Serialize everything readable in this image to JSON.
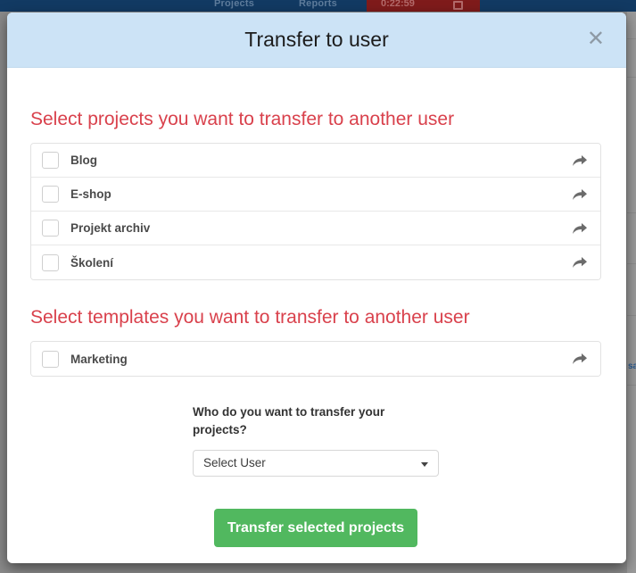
{
  "background": {
    "nav": {
      "projects_label": "Projects",
      "reports_label": "Reports",
      "timer_value": "0:22:59",
      "stop_icon": "stop-square-icon"
    },
    "right_snippet": "sa"
  },
  "modal": {
    "title": "Transfer to user",
    "close_icon": "✕",
    "projects_section": {
      "heading": "Select projects you want to transfer to another user",
      "items": [
        {
          "label": "Blog",
          "share_icon": "share-arrow-icon",
          "checked": false
        },
        {
          "label": "E-shop",
          "share_icon": "share-arrow-icon",
          "checked": false
        },
        {
          "label": "Projekt archiv",
          "share_icon": "share-arrow-icon",
          "checked": false
        },
        {
          "label": "Školení",
          "share_icon": "share-arrow-icon",
          "checked": false
        }
      ]
    },
    "templates_section": {
      "heading": "Select templates you want to transfer to another user",
      "items": [
        {
          "label": "Marketing",
          "share_icon": "share-arrow-icon",
          "checked": false
        }
      ]
    },
    "form": {
      "select_label": "Who do you want to transfer your projects?",
      "select_value": "Select User",
      "select_caret_icon": "chevron-down-icon",
      "submit_label": "Transfer selected projects"
    }
  },
  "colors": {
    "header_bg": "#cce3f6",
    "heading_red": "#d9414c",
    "submit_green": "#51b85f",
    "navbar_blue": "#123a63",
    "timer_red": "#7f1b1b"
  }
}
